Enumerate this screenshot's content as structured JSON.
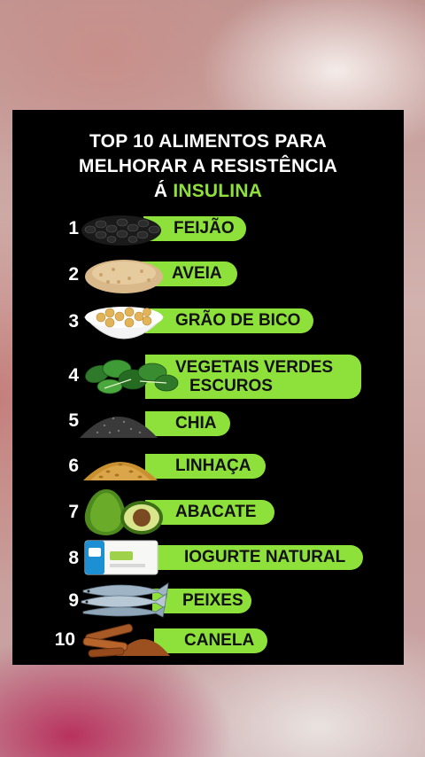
{
  "title": {
    "line1": "TOP 10 ALIMENTOS PARA",
    "line2": "MELHORAR A RESISTÊNCIA",
    "line3_prefix": "Á ",
    "line3_highlight": "INSULINA"
  },
  "accent_color": "#8ee03b",
  "items": [
    {
      "number": "1",
      "label": "FEIJÃO",
      "icon": "black-beans-icon"
    },
    {
      "number": "2",
      "label": "AVEIA",
      "icon": "oats-icon"
    },
    {
      "number": "3",
      "label": "GRÃO DE BICO",
      "icon": "chickpeas-bowl-icon"
    },
    {
      "number": "4",
      "label_line1": "VEGETAIS VERDES",
      "label_line2": "ESCUROS",
      "icon": "leafy-greens-icon"
    },
    {
      "number": "5",
      "label": "CHIA",
      "icon": "chia-seeds-icon"
    },
    {
      "number": "6",
      "label": "LINHAÇA",
      "icon": "flaxseed-icon"
    },
    {
      "number": "7",
      "label": "ABACATE",
      "icon": "avocado-icon"
    },
    {
      "number": "8",
      "label": "IOGURTE NATURAL",
      "icon": "yogurt-icon"
    },
    {
      "number": "9",
      "label": "PEIXES",
      "icon": "fish-icon"
    },
    {
      "number": "10",
      "label": "CANELA",
      "icon": "cinnamon-icon"
    }
  ]
}
